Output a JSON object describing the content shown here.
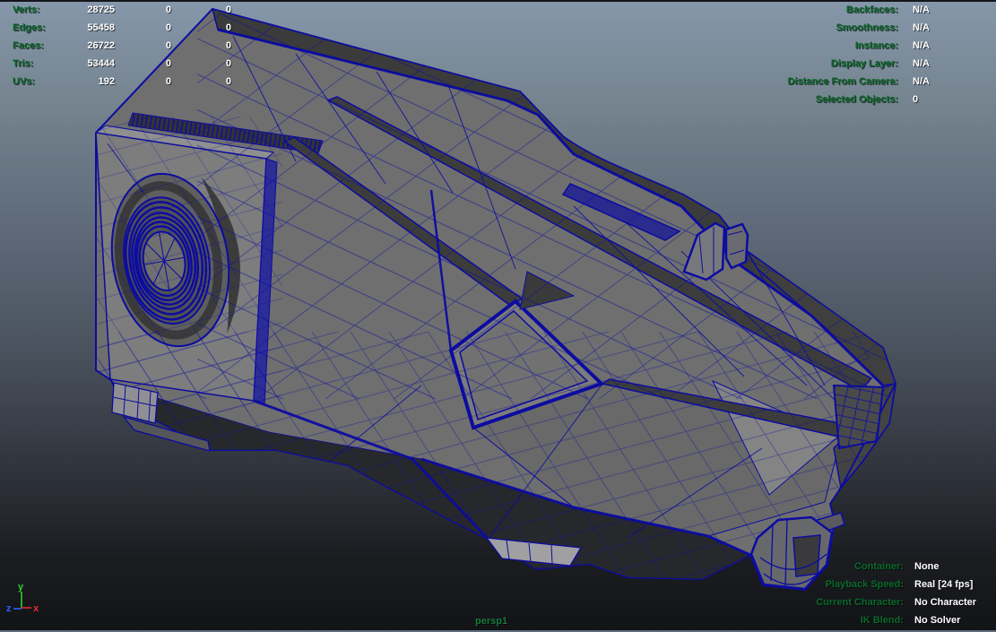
{
  "viewport": {
    "camera_label": "persp1",
    "renderer": "wireframe-on-shaded"
  },
  "axis_gizmo": {
    "x_label": "x",
    "y_label": "y",
    "z_label": "z"
  },
  "hud_top_left": {
    "rows": [
      {
        "label": "Verts:",
        "v1": "28725",
        "v2": "0",
        "v3": "0"
      },
      {
        "label": "Edges:",
        "v1": "55458",
        "v2": "0",
        "v3": "0"
      },
      {
        "label": "Faces:",
        "v1": "26722",
        "v2": "0",
        "v3": "0"
      },
      {
        "label": "Tris:",
        "v1": "53444",
        "v2": "0",
        "v3": "0"
      },
      {
        "label": "UVs:",
        "v1": "192",
        "v2": "0",
        "v3": "0"
      }
    ]
  },
  "hud_top_right": {
    "rows": [
      {
        "label": "Backfaces:",
        "value": "N/A"
      },
      {
        "label": "Smoothness:",
        "value": "N/A"
      },
      {
        "label": "Instance:",
        "value": "N/A"
      },
      {
        "label": "Display Layer:",
        "value": "N/A"
      },
      {
        "label": "Distance From Camera:",
        "value": "N/A"
      },
      {
        "label": "Selected Objects:",
        "value": "0"
      }
    ]
  },
  "hud_bottom_right": {
    "rows": [
      {
        "label": "Container:",
        "value": "None"
      },
      {
        "label": "Playback Speed:",
        "value": "Real [24 fps]"
      },
      {
        "label": "Current Character:",
        "value": "No Character"
      },
      {
        "label": "IK Blend:",
        "value": "No Solver"
      }
    ]
  },
  "colors": {
    "hud_label_green": "#0b6a2b",
    "hud_value_white": "#ffffff",
    "camera_label_green": "#157a3c",
    "wireframe_navy": "#0c0ca0",
    "viewport_gradient_top": "#8697ab",
    "viewport_gradient_bottom": "#121316",
    "axis_x_red": "#e03030",
    "axis_y_green": "#2fd12f",
    "axis_z_blue": "#3060ff"
  }
}
